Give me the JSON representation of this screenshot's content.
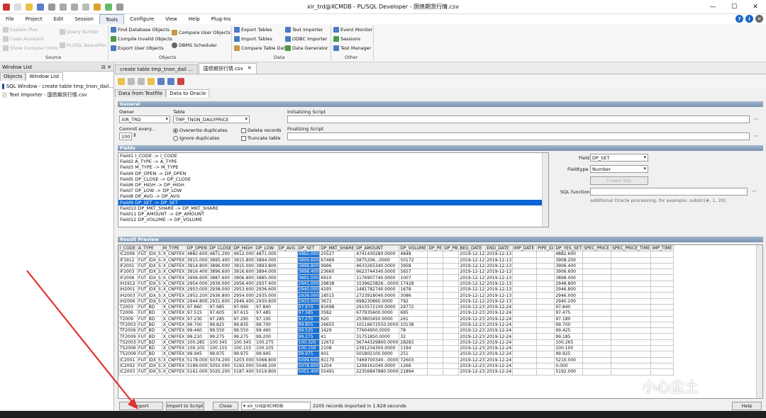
{
  "window": {
    "title": "xir_trd@XCMDB - PL/SQL Developer - 国债期货行情.csv"
  },
  "menu": [
    "File",
    "Project",
    "Edit",
    "Session",
    "Tools",
    "Configure",
    "View",
    "Help",
    "Plug-Ins"
  ],
  "menu_active": "Tools",
  "ribbon": {
    "source": {
      "items": [
        "Explain Plan",
        "Code Assistant",
        "Show Compiler Hints",
        "Query Builder",
        "PL/SQL Beautifier"
      ],
      "label": "Source"
    },
    "objects": {
      "items": [
        "Find Database Objects",
        "Compile Invalid Objects",
        "Export User Objects",
        "Compare User Objects",
        "DBMS Scheduler"
      ],
      "label": "Objects"
    },
    "data": {
      "items": [
        "Export Tables",
        "Import Tables",
        "Compare Table Data",
        "Text Importer",
        "ODBC Importer",
        "Data Generator"
      ],
      "label": "Data"
    },
    "other": {
      "items": [
        "Event Monitor",
        "Sessions",
        "Test Manager"
      ],
      "label": "Other"
    }
  },
  "left_panel": {
    "title": "Window List",
    "tabs": [
      "Objects",
      "Window List"
    ],
    "items": [
      "SQL Window - create table tmp_tnon_dail...",
      "Text Importer - 国债期货行情.csv"
    ]
  },
  "doc_tabs": [
    "create table tmp_tnon_dail ...",
    "国债期货行情.csv"
  ],
  "sub_tabs": [
    "Data from Textfile",
    "Data to Oracle"
  ],
  "general": {
    "header": "General",
    "owner_label": "Owner",
    "owner_value": "XIR_TRD",
    "table_label": "Table",
    "table_value": "TMP_TNON_DAILYPRICE",
    "init_script_label": "Initializing Script",
    "final_script_label": "Finalizing Script",
    "commit_label": "Commit every...",
    "commit_value": "100",
    "overwrite_label": "Overwrite duplicates",
    "ignore_label": "Ignore duplicates",
    "delete_label": "Delete records",
    "truncate_label": "Truncate table"
  },
  "fields": {
    "header": "Fields",
    "list": [
      "Field1  I_CODE  ->  I_CODE",
      "Field2  A_TYPE  ->  A_TYPE",
      "Field3  M_TYPE  ->  M_TYPE",
      "Field4  DP_OPEN  ->  DP_OPEN",
      "Field5  DP_CLOSE  ->  DP_CLOSE",
      "Field6  DP_HIGH  ->  DP_HIGH",
      "Field7  DP_LOW  ->  DP_LOW",
      "Field8  DP_AVG  ->  DP_AVG",
      "Field9  DP_SET  ->  DP_SET",
      "Field10  DP_MKT_SHARE  ->  DP_MKT_SHARE",
      "Field11  DP_AMOUNT  ->  DP_AMOUNT",
      "Field12  DP_VOLUME  ->  DP_VOLUME"
    ],
    "selected_index": 8,
    "field_label": "Field",
    "field_value": "DP_SET",
    "fieldtype_label": "Fieldtype",
    "fieldtype_value": "Number",
    "create_sql_label": "Create SQL",
    "sql_function_label": "SQL function",
    "sql_hint": "additional Oracle processing, for example: substr(#, 1, 20)"
  },
  "result": {
    "header": "Result Preview",
    "columns": [
      "I_CODE",
      "A_TYPE",
      "M_TYPE",
      "DP_OPEN",
      "DP_CLOSE",
      "DP_HIGH",
      "DP_LOW",
      "DP_AVG",
      "DP_SET",
      "DP_MKT_SHARE",
      "DP_AMOUNT",
      "DP_VOLUME",
      "DP_PE",
      "DP_PB",
      "BEG_DATE",
      "END_DATE",
      "IMP_DATE",
      "PIPE_ID",
      "DP_YES_SET",
      "SPEC_PRICE",
      "SPEC_PRICE_TIME",
      "IMP_TIME"
    ],
    "rows": [
      [
        "IC2006",
        "FUT_IDX_S",
        "X_CNFFEX",
        "4882.600",
        "4871.200",
        "4912.000",
        "4871.000",
        "",
        "4882.000",
        "25527",
        "4741430280.0000",
        "4848",
        "",
        "",
        "2019-12-12",
        "2019-12-13",
        "",
        "",
        "4882.600",
        "",
        "",
        ""
      ],
      [
        "IF1912",
        "FUT_IDX_S",
        "X_CNFFEX",
        "3915.000",
        "3895.400",
        "3915.800",
        "3894.000",
        "",
        "3899.600",
        "67469",
        "5875206...0000",
        "50172",
        "",
        "",
        "2019-12-12",
        "2019-12-13",
        "",
        "",
        "3908.200",
        "",
        "",
        ""
      ],
      [
        "IF2001",
        "FUT_IDX_S",
        "X_CNFFEX",
        "3914.800",
        "3896.000",
        "3915.000",
        "3893.800",
        "",
        "3898.800",
        "9996",
        "4633265340.0000",
        "3958",
        "",
        "",
        "2019-12-12",
        "2019-12-13",
        "",
        "",
        "3906.400",
        "",
        "",
        ""
      ],
      [
        "IF2003",
        "FUT_IDX_S",
        "X_CNFFEX",
        "3916.400",
        "3896.600",
        "3916.600",
        "3894.000",
        "",
        "3898.400",
        "23660",
        "6623744340.0000",
        "5657",
        "",
        "",
        "2019-12-12",
        "2019-12-13",
        "",
        "",
        "3906.600",
        "",
        "",
        ""
      ],
      [
        "IF2006",
        "FUT_IDX_S",
        "X_CNFFEX",
        "3906.600",
        "3887.600",
        "3906.800",
        "3885.000",
        "",
        "3891.000",
        "6910",
        "1176907740.0000",
        "1007",
        "",
        "",
        "2019-12-12",
        "2019-12-13",
        "",
        "",
        "3898.000",
        "",
        "",
        ""
      ],
      [
        "IH1912",
        "FUT_IDX_S",
        "X_CNFFEX",
        "2954.000",
        "2939.000",
        "2956.400",
        "2937.400",
        "",
        "2941.000",
        "29838",
        "1539623826...0000",
        "17428",
        "",
        "",
        "2019-12-12",
        "2019-12-13",
        "",
        "",
        "2948.800",
        "",
        "",
        ""
      ],
      [
        "IH2001",
        "FUT_IDX_S",
        "X_CNFFEX",
        "2953.000",
        "2938.000",
        "2953.600",
        "2936.600",
        "",
        "2940.000",
        "4295",
        "1481782740.0000",
        "1678",
        "",
        "",
        "2019-12-12",
        "2019-12-13",
        "",
        "",
        "2946.800",
        "",
        "",
        ""
      ],
      [
        "IH2003",
        "FUT_IDX_S",
        "X_CNFFEX",
        "2952.200",
        "2936.800",
        "2954.000",
        "2935.000",
        "",
        "2938.000",
        "18515",
        "2723918040.0000",
        "3086",
        "",
        "",
        "2019-12-12",
        "2019-12-13",
        "",
        "",
        "2946.000",
        "",
        "",
        ""
      ],
      [
        "IH2006",
        "FUT_IDX_S",
        "X_CNFFEX",
        "2944.800",
        "2931.600",
        "2946.400",
        "2930.600",
        "",
        "2933.000",
        "3672",
        "698230860.0000",
        "792",
        "",
        "",
        "2019-12-12",
        "2019-12-13",
        "",
        "",
        "2940.200",
        "",
        "",
        ""
      ],
      [
        "T2003",
        "FUT_BD",
        "X_CNFFEX",
        "97.860",
        "97.985",
        "97.990",
        "97.840",
        "",
        "97.970",
        "81698",
        "2915572100.0000",
        "29772",
        "",
        "",
        "2019-12-23",
        "2019-12-24",
        "",
        "",
        "97.840",
        "",
        "",
        ""
      ],
      [
        "T2006",
        "FUT_BD",
        "X_CNFFEX",
        "97.515",
        "97.605",
        "97.615",
        "97.485",
        "",
        "97.585",
        "3582",
        "677935600.0000",
        "695",
        "",
        "",
        "2019-12-23",
        "2019-12-24",
        "",
        "",
        "97.475",
        "",
        "",
        ""
      ],
      [
        "T2009",
        "FUT_BD",
        "X_CNFFEX",
        "97.230",
        "97.285",
        "97.295",
        "97.195",
        "",
        "97.270",
        "620",
        "253803450.0000",
        "261",
        "",
        "",
        "2019-12-23",
        "2019-12-24",
        "",
        "",
        "97.180",
        "",
        "",
        ""
      ],
      [
        "TF2003",
        "FUT_BD",
        "X_CNFFEX",
        "99.700",
        "99.825",
        "99.835",
        "99.700",
        "",
        "99.805",
        "26655",
        "10116672550.0000",
        "10138",
        "",
        "",
        "2019-12-23",
        "2019-12-24",
        "",
        "",
        "99.700",
        "",
        "",
        ""
      ],
      [
        "TF2006",
        "FUT_BD",
        "X_CNFFEX",
        "99.460",
        "99.550",
        "99.550",
        "99.460",
        "",
        "99.535",
        "1429",
        "77604950.0000",
        "78",
        "",
        "",
        "2019-12-23",
        "2019-12-24",
        "",
        "",
        "99.425",
        "",
        "",
        ""
      ],
      [
        "TF2009",
        "FUT_BD",
        "X_CNFFEX",
        "99.210",
        "99.275",
        "99.275",
        "99.200",
        "",
        "99.275",
        "41",
        "31751850.0000",
        "32",
        "",
        "",
        "2019-12-23",
        "2019-12-24",
        "",
        "",
        "99.185",
        "",
        "",
        ""
      ],
      [
        "TS2003",
        "FUT_BD",
        "X_CNFFEX",
        "100.285",
        "100.345",
        "100.345",
        "100.275",
        "",
        "100.320",
        "12672",
        "56744329800.0000",
        "28283",
        "",
        "",
        "2019-12-23",
        "2019-12-24",
        "",
        "",
        "100.265",
        "",
        "",
        ""
      ],
      [
        "TS2006",
        "FUT_BD",
        "X_CNFFEX",
        "100.105",
        "100.155",
        "100.155",
        "100.105",
        "",
        "100.150",
        "2108",
        "2391234300.0000",
        "1194",
        "",
        "",
        "2019-12-23",
        "2019-12-24",
        "",
        "",
        "100.100",
        "",
        "",
        ""
      ],
      [
        "TS2009",
        "FUT_BD",
        "X_CNFFEX",
        "99.945",
        "99.975",
        "99.975",
        "99.945",
        "",
        "99.975",
        "401",
        "501802100.0000",
        "251",
        "",
        "",
        "2019-12-23",
        "2019-12-24",
        "",
        "",
        "99.925",
        "",
        "",
        ""
      ],
      [
        "IC2001",
        "FUT_IDX_S",
        "X_CNFFEX",
        "5178.000",
        "5074.200",
        "5203.000",
        "5068.800",
        "",
        "5099.600",
        "81170",
        "7469700340...0000",
        "72603",
        "",
        "",
        "2019-12-23",
        "2019-12-24",
        "",
        "",
        "5210.000",
        "",
        "",
        ""
      ],
      [
        "IC2002",
        "FUT_IDX_S",
        "X_CNFFEX",
        "5189.000",
        "5050.000",
        "5193.000",
        "5048.200",
        "",
        "5078.600",
        "1204",
        "1299161040.0000",
        "1266",
        "",
        "",
        "2019-12-23",
        "2019-12-24",
        "",
        "",
        "0.000",
        "",
        "",
        ""
      ],
      [
        "IC2003",
        "FUT_IDX_S",
        "X_CNFFEX",
        "5161.000",
        "5020.200",
        "5187.400",
        "5019.800",
        "",
        "5051.400",
        "55491",
        "22356847880.0000",
        "21894",
        "",
        "",
        "2019-12-23",
        "2019-12-24",
        "",
        "",
        "5192.000",
        "",
        "",
        ""
      ]
    ],
    "highlight_col": 8
  },
  "footer": {
    "import": "Import",
    "import_to_script": "Import to Script",
    "close": "Close",
    "connection": "xir_trd@XCMDB",
    "status": "2205 records imported in 1.828 seconds",
    "help": "Help"
  },
  "watermark": "小心尘土",
  "colors": {
    "selection": "#0a64d4",
    "header_grad": "#7a93b0",
    "arrow": "#e03030"
  }
}
